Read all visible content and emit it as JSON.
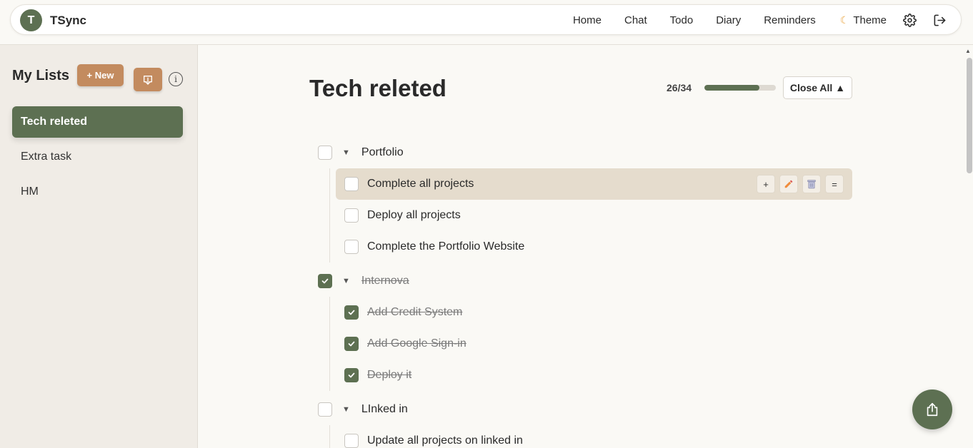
{
  "app": {
    "avatar_letter": "T",
    "name": "TSync"
  },
  "nav": {
    "links": [
      "Home",
      "Chat",
      "Todo",
      "Diary",
      "Reminders"
    ],
    "theme_label": "Theme",
    "accent": "#5d7052"
  },
  "sidebar": {
    "title": "My Lists",
    "new_label": "+ New",
    "info_label": "i",
    "items": [
      {
        "label": "Tech releted",
        "active": true
      },
      {
        "label": "Extra task",
        "active": false
      },
      {
        "label": "HM",
        "active": false
      }
    ]
  },
  "main": {
    "title": "Tech releted",
    "progress_text": "26/34",
    "progress_fraction": 0.765,
    "close_all_label": "Close All ▲",
    "groups": [
      {
        "label": "Portfolio",
        "done": false,
        "items": [
          {
            "label": "Complete all projects",
            "done": false
          },
          {
            "label": "Deploy all projects",
            "done": false
          },
          {
            "label": "Complete the Portfolio Website",
            "done": false
          }
        ]
      },
      {
        "label": "Internova",
        "done": true,
        "items": [
          {
            "label": "Add Credit System",
            "done": true
          },
          {
            "label": "Add Google Sign-in",
            "done": true
          },
          {
            "label": "Deploy it",
            "done": true
          }
        ]
      },
      {
        "label": "LInked in",
        "done": false,
        "items": [
          {
            "label": "Update all projects on linked in",
            "done": false
          }
        ]
      }
    ],
    "row_actions": {
      "add": "+",
      "reorder": "="
    }
  },
  "colors": {
    "primary": "#5d7052",
    "secondary": "#c38b5f",
    "background": "#faf9f5",
    "sidebar": "#f0ece6"
  }
}
